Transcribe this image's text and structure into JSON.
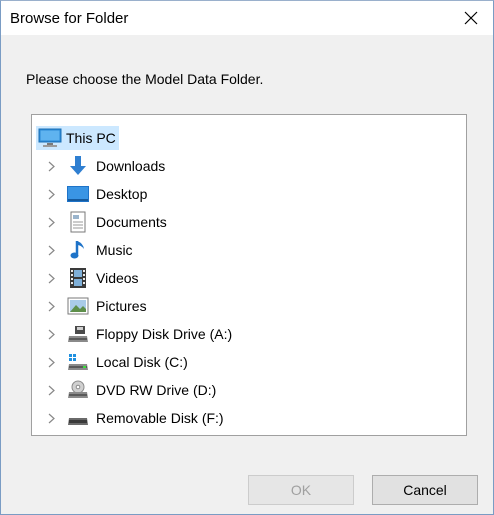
{
  "window": {
    "title": "Browse for Folder",
    "close_icon": "close-icon"
  },
  "instruction": "Please choose the Model Data Folder.",
  "tree": {
    "root": {
      "label": "This PC",
      "icon": "this-pc-icon",
      "selected": true
    },
    "items": [
      {
        "label": "Downloads",
        "icon": "downloads-icon"
      },
      {
        "label": "Desktop",
        "icon": "desktop-icon"
      },
      {
        "label": "Documents",
        "icon": "documents-icon"
      },
      {
        "label": "Music",
        "icon": "music-icon"
      },
      {
        "label": "Videos",
        "icon": "videos-icon"
      },
      {
        "label": "Pictures",
        "icon": "pictures-icon"
      },
      {
        "label": "Floppy Disk Drive (A:)",
        "icon": "floppy-drive-icon"
      },
      {
        "label": "Local Disk (C:)",
        "icon": "local-disk-icon"
      },
      {
        "label": "DVD RW Drive (D:)",
        "icon": "dvd-drive-icon"
      },
      {
        "label": "Removable Disk (F:)",
        "icon": "removable-disk-icon"
      }
    ]
  },
  "buttons": {
    "ok_label": "OK",
    "ok_enabled": false,
    "cancel_label": "Cancel"
  },
  "colors": {
    "selection": "#cce8ff",
    "accent": "#0078d7",
    "disabled_text": "#a0a0a0"
  }
}
